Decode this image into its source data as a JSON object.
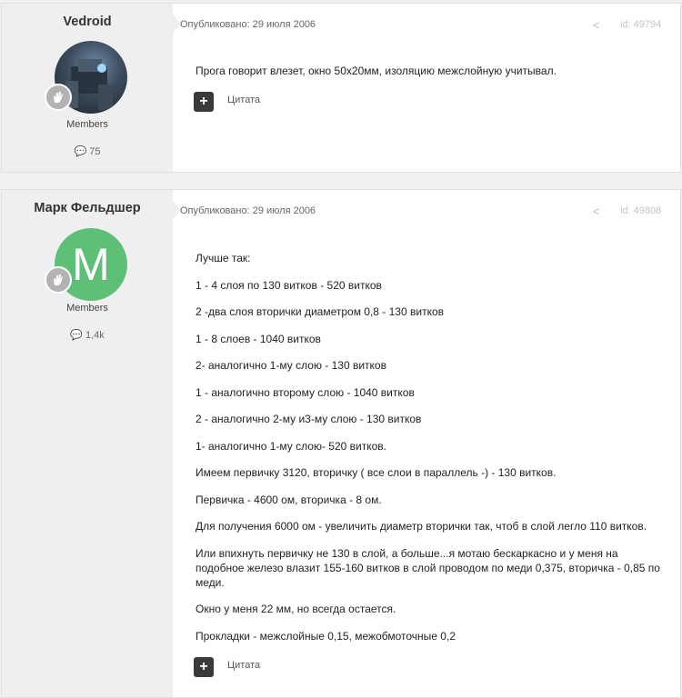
{
  "posts": [
    {
      "author": "Vedroid",
      "group": "Members",
      "post_count": "75",
      "published": "Опубликовано: 29 июля 2006",
      "post_id": "id: 49794",
      "content": [
        "Прога говорит влезет, окно 50х20мм, изоляцию межслойную учитывал."
      ],
      "quote_label": "Цитата"
    },
    {
      "author": "Марк Фельдшер",
      "avatar_letter": "M",
      "group": "Members",
      "post_count": "1,4k",
      "published": "Опубликовано: 29 июля 2006",
      "post_id": "id: 49808",
      "content": [
        "Лучше так:",
        "1 - 4 слоя по 130 витков - 520 витков",
        "2 -два слоя вторички диаметром 0,8 - 130 витков",
        "1 - 8 слоев - 1040 витков",
        "2- аналогично 1-му слою - 130 витков",
        "1 - аналогично второму слою - 1040 витков",
        "2 - аналогично 2-му и3-му слою - 130 витков",
        "1- аналогично 1-му слою- 520 витков.",
        "Имеем первичку 3120, вторичку ( все слои в параллель -) - 130 витков.",
        "Первичка - 4600 ом, вторичка - 8 ом.",
        "Для получения 6000 ом - увеличить диаметр вторички так, чтоб в слой легло 110 витков.",
        "Или впихнуть первичку не 130 в слой, а больше...я мотаю бескаркасно и у меня на подобное железо влазит 155-160 витков в слой проводом по меди 0,375, вторичка - 0,85 по меди.",
        "Окно у меня 22 мм, но всегда остается.",
        "Прокладки - межслойные 0,15, межобмоточные 0,2"
      ],
      "quote_label": "Цитата"
    }
  ],
  "colors": {
    "avatar_green": "#5ebf77",
    "badge_grey": "#b3b3b3",
    "quote_button": "#3a3a3a"
  },
  "icons": {
    "share": "share-icon",
    "comment": "comment-icon",
    "rank": "rank-hand-icon",
    "quote_plus": "plus-icon"
  }
}
